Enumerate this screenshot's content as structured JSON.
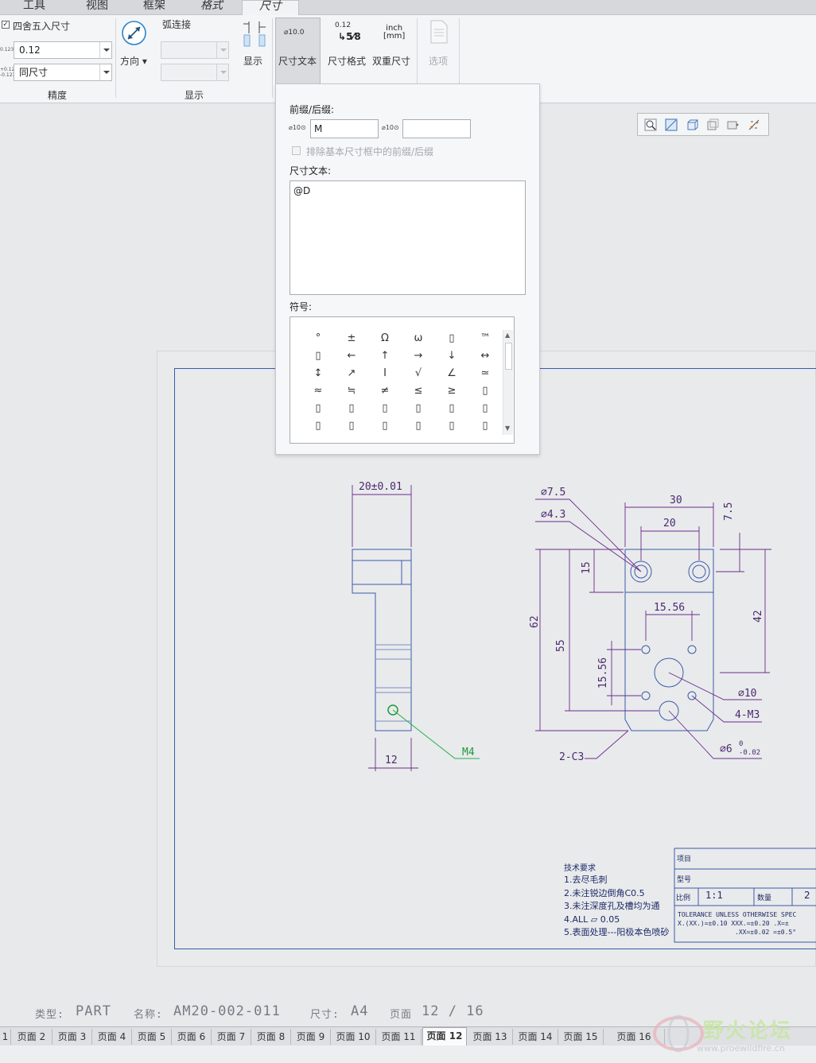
{
  "ribbon": {
    "tabs": [
      "工具",
      "视图",
      "框架",
      "格式",
      "尺寸"
    ],
    "precision": {
      "round_label": "四舍五入尺寸",
      "round_checked": true,
      "decimal_value": "0.12",
      "tolerance_value": "同尺寸",
      "group_label": "精度",
      "icon_prefix_1": "0.123",
      "icon_prefix_2a": "+0.123",
      "icon_prefix_2b": "-0.123"
    },
    "display": {
      "direction_label": "方向",
      "arc_label": "弧连接",
      "show_label": "显示",
      "group_label": "显示"
    },
    "buttons": {
      "dim_text": "尺寸文本",
      "dim_text_icon": "⌀10.0",
      "dim_format": "尺寸格式",
      "dim_format_top": "0.12",
      "dim_format_frac": "5⁄8",
      "dual_dim": "双重尺寸",
      "dual_top": "inch",
      "dual_bottom": "[mm]",
      "options": "选项"
    }
  },
  "panel": {
    "prefix_suffix_label": "前缀/后缀:",
    "prefix_icon": "⌀10⊙",
    "prefix_value": "M",
    "suffix_icon": "⌀10⊙",
    "suffix_value": "",
    "exclude_label": "排除基本尺寸框中的前缀/后缀",
    "dim_text_label": "尺寸文本:",
    "dim_text_value": "@D",
    "symbols_label": "符号:",
    "symbols": [
      "°",
      "±",
      "Ω",
      "ω",
      "▯",
      "™",
      "▯",
      "←",
      "↑",
      "→",
      "↓",
      "↔",
      "↕",
      "↗",
      "Ι",
      "√",
      "∠",
      "≃",
      "≈",
      "≒",
      "≠",
      "≤",
      "≥",
      "▯",
      "▯",
      "▯",
      "▯",
      "▯",
      "▯",
      "▯",
      "▯",
      "▯",
      "▯",
      "▯",
      "▯",
      "▯"
    ]
  },
  "drawing": {
    "dims": {
      "d20": "20±0.01",
      "d12": "12",
      "m4": "M4",
      "d30": "30",
      "d20b": "20",
      "d75": "7.5",
      "d15": "15",
      "d1556a": "15.56",
      "d62": "62",
      "d55": "55",
      "d1556b": "15.56",
      "d42": "42",
      "phi75": "⌀7.5",
      "phi43": "⌀4.3",
      "phi10": "⌀10",
      "m3": "4-M3",
      "phi6": "⌀6",
      "phi6_tol_top": "0",
      "phi6_tol_bot": "-0.02",
      "c3": "2-C3"
    },
    "tech": {
      "title": "技术要求",
      "lines": [
        "1.去尽毛刺",
        "2.未注锐边倒角C0.5",
        "3.未注深度孔及槽均为通",
        "4.ALL  ▱  0.05",
        "5.表面处理---阳极本色喷砂"
      ]
    },
    "titleblock": {
      "item": "项目",
      "model": "型号",
      "scale_label": "比例",
      "scale_value": "1:1",
      "qty_label": "数量",
      "qty_value": "2",
      "tol1": "TOLERANCE UNLESS OTHERWISE SPEC",
      "tol2": "X.(XX.)=±0.10 XXX.=±0.20 .X=±",
      "tol3": ".XX=±0.02  =±0.5°"
    },
    "info": {
      "type_label": "类型:",
      "type_value": "PART",
      "name_label": "名称:",
      "name_value": "AM20-002-011",
      "size_label": "尺寸:",
      "size_value": "A4",
      "page_label": "页面",
      "page_value": "12 / 16"
    }
  },
  "page_tabs": [
    "1",
    "页面 2",
    "页面 3",
    "页面 4",
    "页面 5",
    "页面 6",
    "页面 7",
    "页面 8",
    "页面 9",
    "页面 10",
    "页面 11",
    "页面 12",
    "页面 13",
    "页面 14",
    "页面 15",
    "页面 16"
  ],
  "active_page_tab": "页面 12",
  "watermark": {
    "text": "野火论坛",
    "url": "www.proewildfire.cn"
  }
}
